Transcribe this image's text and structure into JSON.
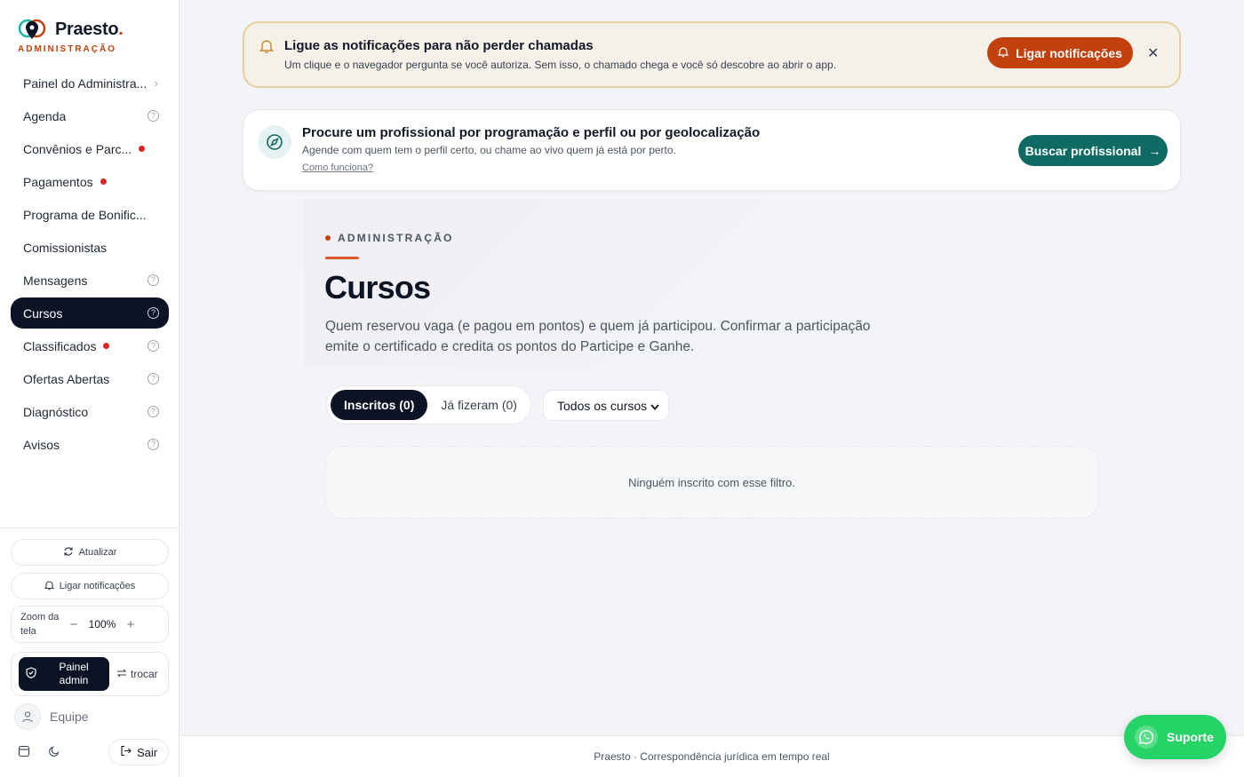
{
  "brand": {
    "name": "Praesto",
    "dot": ".",
    "subtitle": "ADMINISTRAÇÃO"
  },
  "sidebar": {
    "items": [
      {
        "label": "Painel do Administra..."
      },
      {
        "label": "Agenda"
      },
      {
        "label": "Convênios e Parc..."
      },
      {
        "label": "Pagamentos"
      },
      {
        "label": "Programa de Bonific..."
      },
      {
        "label": "Comissionistas"
      },
      {
        "label": "Mensagens"
      },
      {
        "label": "Cursos"
      },
      {
        "label": "Classificados"
      },
      {
        "label": "Ofertas Abertas"
      },
      {
        "label": "Diagnóstico"
      },
      {
        "label": "Avisos"
      }
    ],
    "help_glyph": "?",
    "refresh_label": "Atualizar",
    "notify_label": "Ligar notificações",
    "zoom_label": "Zoom da tela",
    "zoom_minus": "−",
    "zoom_value": "100%",
    "zoom_plus": "+",
    "panel_admin_label": "Painel admin",
    "switch_label": "trocar",
    "team_label": "Equipe",
    "logout_label": "Sair"
  },
  "notification_banner": {
    "title": "Ligue as notificações para não perder chamadas",
    "text": "Um clique e o navegador pergunta se você autoriza. Sem isso, o chamado chega e você só descobre ao abrir o app.",
    "button_label": "Ligar notificações",
    "close_glyph": "✕"
  },
  "search_card": {
    "title": "Procure um profissional por programação e perfil ou por geolocalização",
    "text": "Agende com quem tem o perfil certo, ou chame ao vivo quem já está por perto.",
    "link": "Como funciona?",
    "button_label": "Buscar profissional",
    "button_arrow": "→"
  },
  "page": {
    "eyebrow": "ADMINISTRAÇÃO",
    "title": "Cursos",
    "description": "Quem reservou vaga (e pagou em pontos) e quem já participou. Confirmar a participação emite o certificado e credita os pontos do Participe e Ganhe."
  },
  "tabs": [
    {
      "label": "Inscritos (0)"
    },
    {
      "label": "Já fizeram (0)"
    }
  ],
  "course_filter": {
    "value": "Todos os cursos",
    "chevron": "⌄"
  },
  "empty_state": "Ninguém inscrito com esse filtro.",
  "footer": "Praesto · Correspondência jurídica em tempo real",
  "support_label": "Suporte",
  "colors": {
    "brand_orange": "#c2410c",
    "nav_active": "#0b1324",
    "teal": "#0f6a63",
    "whatsapp": "#25d366",
    "alert_dot": "#dc2626"
  }
}
